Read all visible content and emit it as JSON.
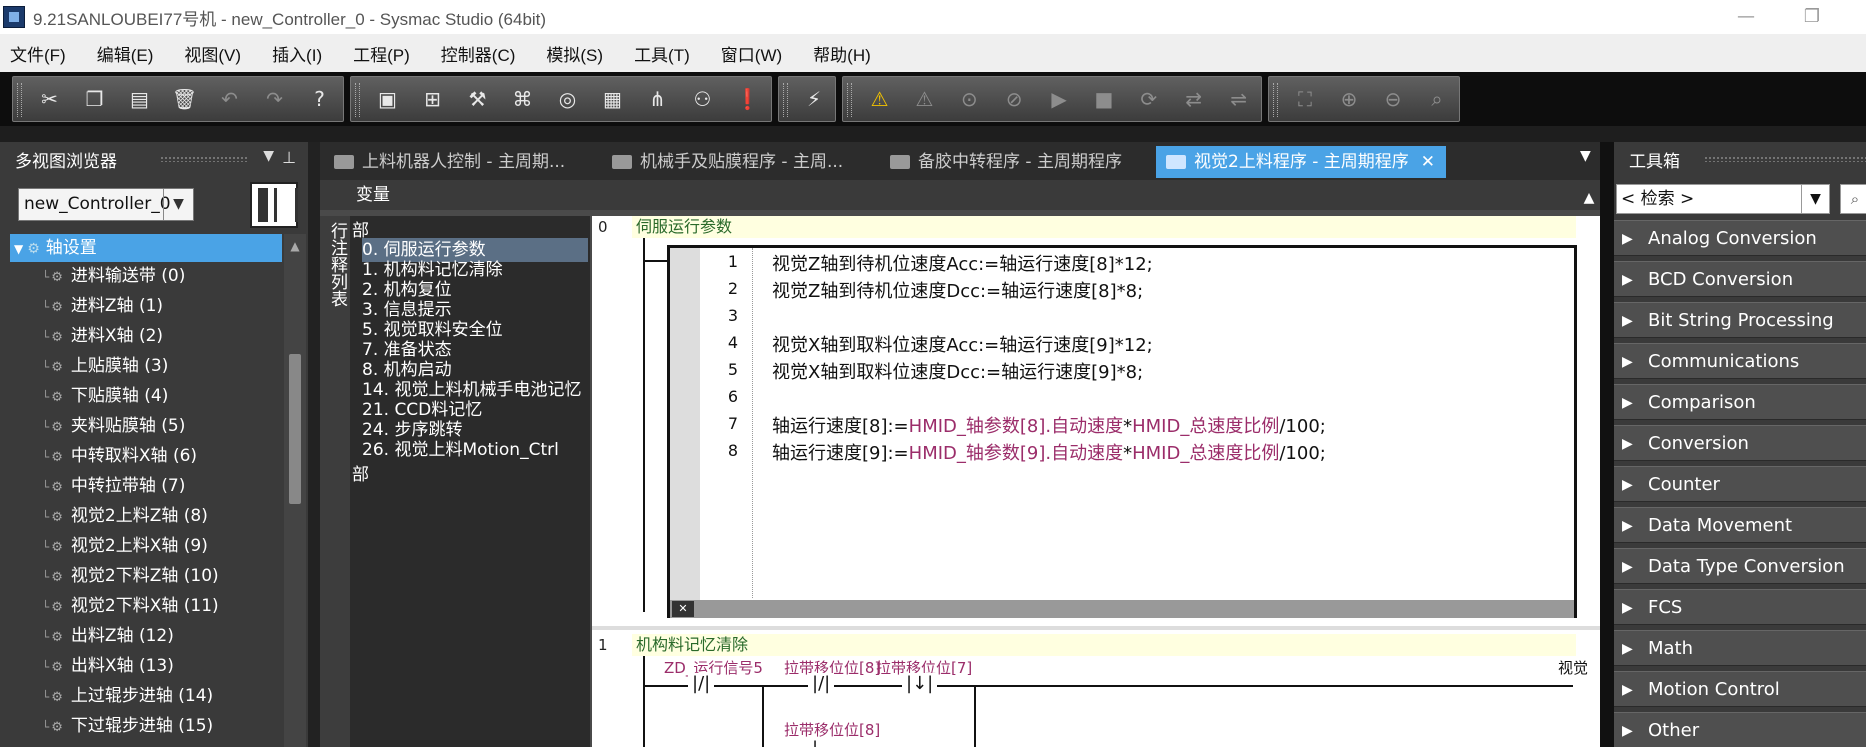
{
  "window": {
    "title": "9.21SANLOUBEI77号机 - new_Controller_0 - Sysmac Studio (64bit)",
    "minimize": "—",
    "restore": "❐"
  },
  "menu": [
    "文件(F)",
    "编辑(E)",
    "视图(V)",
    "插入(I)",
    "工程(P)",
    "控制器(C)",
    "模拟(S)",
    "工具(T)",
    "窗口(W)",
    "帮助(H)"
  ],
  "left_panel": {
    "title": "多视图浏览器",
    "controller": "new_Controller_0",
    "selected_node": "轴设置",
    "axes": [
      "进料输送带 (0)",
      "进料Z轴 (1)",
      "进料X轴 (2)",
      "上贴膜轴 (3)",
      "下贴膜轴 (4)",
      "夹料贴膜轴 (5)",
      "中转取料X轴 (6)",
      "中转拉带轴 (7)",
      "视觉2上料Z轴 (8)",
      "视觉2上料X轴 (9)",
      "视觉2下料Z轴 (10)",
      "视觉2下料X轴 (11)",
      "出料Z轴 (12)",
      "出料X轴 (13)",
      "上过辊步进轴 (14)",
      "下过辊步进轴 (15)"
    ]
  },
  "tabs": [
    {
      "label": "上料机器人控制 - 主周期..."
    },
    {
      "label": "机械手及贴膜程序 - 主周..."
    },
    {
      "label": "备胶中转程序 - 主周期程序"
    },
    {
      "label": "视觉2上料程序 - 主周期程序",
      "active": true
    }
  ],
  "editor": {
    "variables_label": "变量",
    "side_label": "行注释列表",
    "section_header_top": "部",
    "section_header_bottom": "部",
    "sections": [
      "0. 伺服运行参数",
      "1. 机构料记忆清除",
      "2. 机构复位",
      "3. 信息提示",
      "5. 视觉取料安全位",
      "7. 准备状态",
      "8. 机构启动",
      "14. 视觉上料机械手电池记忆",
      "21. CCD料记忆",
      "24. 步序跳转",
      "26. 视觉上料Motion_Ctrl"
    ],
    "rung0": {
      "number": "0",
      "comment": "伺服运行参数"
    },
    "st_code": [
      {
        "n": "1",
        "text": "视觉Z轴到待机位速度Acc:=轴运行速度[8]*12;"
      },
      {
        "n": "2",
        "text": "视觉Z轴到待机位速度Dcc:=轴运行速度[8]*8;"
      },
      {
        "n": "3",
        "text": ""
      },
      {
        "n": "4",
        "text": "视觉X轴到取料位速度Acc:=轴运行速度[9]*12;"
      },
      {
        "n": "5",
        "text": "视觉X轴到取料位速度Dcc:=轴运行速度[9]*8;"
      },
      {
        "n": "6",
        "text": ""
      },
      {
        "n": "7",
        "pre": "轴运行速度[8]:=",
        "v1": "HMID_轴参数[8].自动速度",
        "mid": "*",
        "v2": "HMID_总速度比例",
        "post": "/100;"
      },
      {
        "n": "8",
        "pre": "轴运行速度[9]:=",
        "v1": "HMID_轴参数[9].自动速度",
        "mid": "*",
        "v2": "HMID_总速度比例",
        "post": "/100;"
      }
    ],
    "rung1": {
      "number": "1",
      "comment": "机构料记忆清除",
      "contacts": [
        "ZD_运行信号5",
        "拉带移位位[8]",
        "拉带移位位[7]",
        "拉带移位位[8]"
      ],
      "coil_label": "视觉"
    }
  },
  "toolbox": {
    "title": "工具箱",
    "search_placeholder": "< 检索 >",
    "categories": [
      "Analog Conversion",
      "BCD Conversion",
      "Bit String Processing",
      "Communications",
      "Comparison",
      "Conversion",
      "Counter",
      "Data Movement",
      "Data Type Conversion",
      "FCS",
      "Math",
      "Motion Control",
      "Other"
    ]
  }
}
